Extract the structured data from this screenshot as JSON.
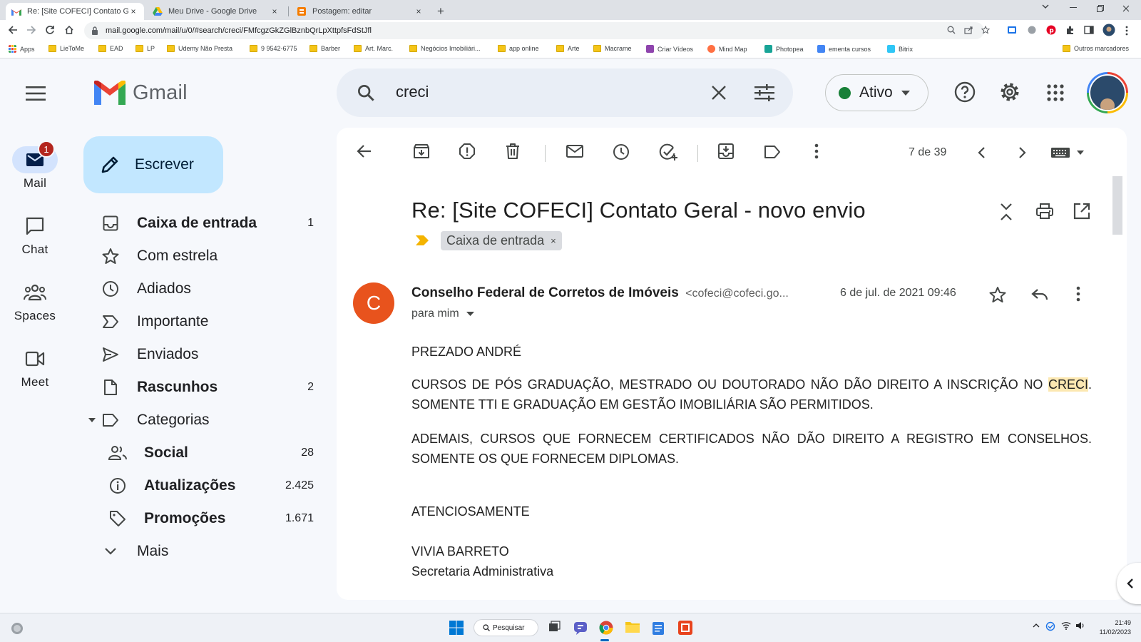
{
  "browser": {
    "tabs": [
      {
        "title": "Re: [Site COFECI] Contato Geral -",
        "close": "×"
      },
      {
        "title": "Meu Drive - Google Drive",
        "close": "×"
      },
      {
        "title": "Postagem: editar",
        "close": "×"
      }
    ],
    "new_tab": "+",
    "url": "mail.google.com/mail/u/0/#search/creci/FMfcgzGkZGlBznbQrLpXttpfsFdStJfl",
    "bookmarks": [
      "Apps",
      "LieToMe",
      "EAD",
      "LP",
      "Udemy Não Presta",
      "9 9542-6775",
      "Barber",
      "Art. Marc.",
      "Negócios Imobiliári...",
      "app online",
      "Arte",
      "Macrame",
      "Criar Vídeos",
      "Mind Map",
      "Photopea",
      "ementa cursos",
      "Bitrix",
      "Outros marcadores"
    ]
  },
  "gmail": {
    "logo_text": "Gmail",
    "search": {
      "query": "creci"
    },
    "status": "Ativo",
    "rail": [
      {
        "label": "Mail",
        "badge": "1"
      },
      {
        "label": "Chat"
      },
      {
        "label": "Spaces"
      },
      {
        "label": "Meet"
      }
    ],
    "compose_label": "Escrever",
    "folders": [
      {
        "label": "Caixa de entrada",
        "count": "1"
      },
      {
        "label": "Com estrela",
        "count": ""
      },
      {
        "label": "Adiados",
        "count": ""
      },
      {
        "label": "Importante",
        "count": ""
      },
      {
        "label": "Enviados",
        "count": ""
      },
      {
        "label": "Rascunhos",
        "count": "2"
      },
      {
        "label": "Categorias",
        "count": ""
      },
      {
        "label": "Social",
        "count": "28"
      },
      {
        "label": "Atualizações",
        "count": "2.425"
      },
      {
        "label": "Promoções",
        "count": "1.671"
      },
      {
        "label": "Mais",
        "count": ""
      }
    ],
    "pager": "7 de 39",
    "email": {
      "subject": "Re: [Site COFECI] Contato Geral - novo envio",
      "label_chip": "Caixa de entrada",
      "label_chip_close": "×",
      "avatar_letter": "C",
      "sender_name": "Conselho Federal de Corretos de Imóveis",
      "sender_email": "<cofeci@cofeci.go...",
      "date": "6 de jul. de 2021 09:46",
      "recipient": "para mim",
      "body": {
        "greeting": "PREZADO ANDRÉ",
        "p1_start": "CURSOS DE PÓS GRADUAÇÃO, MESTRADO OU DOUTORADO NÃO DÃO DIREITO A INSCRIÇÃO NO ",
        "p1_highlight": "CRECI",
        "p1_end": ". SOMENTE TTI E GRADUAÇÃO EM GESTÃO IMOBILIÁRIA SÃO PERMITIDOS.",
        "p2": "ADEMAIS, CURSOS QUE FORNECEM CERTIFICADOS NÃO DÃO DIREITO A REGISTRO EM CONSELHOS. SOMENTE OS QUE FORNECEM DIPLOMAS.",
        "closing": "ATENCIOSAMENTE",
        "signature_name": "VIVIA BARRETO",
        "signature_role": "Secretaria Administrativa"
      }
    }
  },
  "taskbar": {
    "search_label": "Pesquisar",
    "time": "21:49",
    "date": "11/02/2023"
  },
  "colors": {
    "compose_bg": "#c2e7ff",
    "rail_active": "#d3e3fd",
    "badge": "#b3261e",
    "sender_avatar": "#e8531d",
    "status_dot": "#188038",
    "highlight": "#fce8b2"
  }
}
